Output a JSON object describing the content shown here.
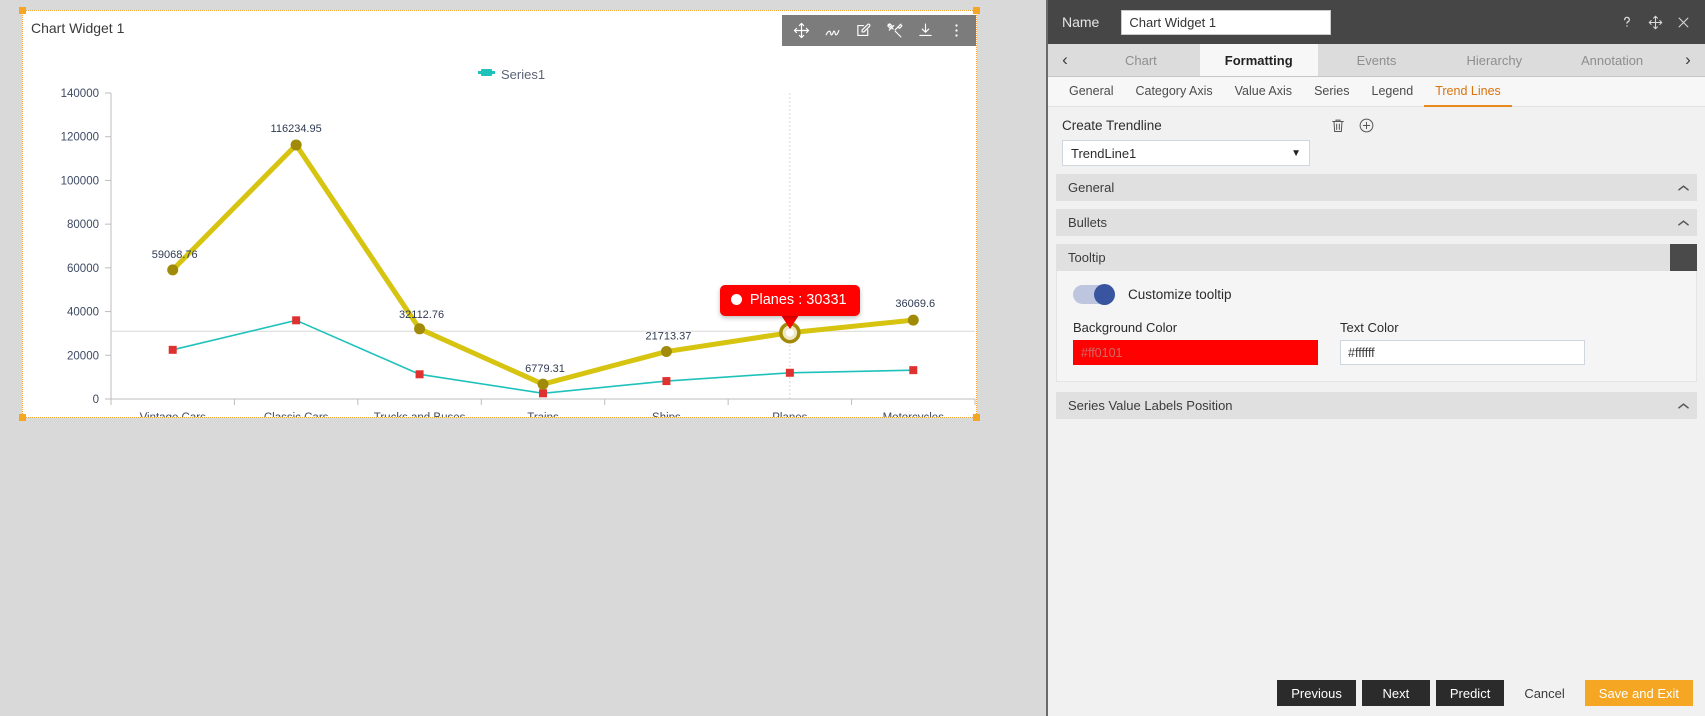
{
  "widget": {
    "title": "Chart Widget 1",
    "toolbar": [
      {
        "name": "move-icon",
        "label": "Move"
      },
      {
        "name": "scribble-icon",
        "label": "Scribble"
      },
      {
        "name": "edit-icon",
        "label": "Edit"
      },
      {
        "name": "tools-icon",
        "label": "Tools"
      },
      {
        "name": "download-icon",
        "label": "Download"
      },
      {
        "name": "more-vertical-icon",
        "label": "More"
      }
    ]
  },
  "chart_data": {
    "type": "line",
    "title": "",
    "xlabel": "",
    "ylabel": "",
    "ylim": [
      0,
      140000
    ],
    "yticks": [
      "0",
      "20000",
      "40000",
      "60000",
      "80000",
      "100000",
      "120000",
      "140000"
    ],
    "ytick_values": [
      0,
      20000,
      40000,
      60000,
      80000,
      100000,
      120000,
      140000
    ],
    "categories": [
      "Vintage Cars",
      "Classic Cars",
      "Trucks and Buses",
      "Trains",
      "Ships",
      "Planes",
      "Motorcycles"
    ],
    "grid": false,
    "legend": {
      "position": "top",
      "entries": [
        {
          "label": "Series1",
          "color": "#1fc2bb"
        }
      ]
    },
    "series": [
      {
        "name": "Series1",
        "color": "#1fc2bb",
        "marker_color": "#e03131",
        "values": [
          22500,
          36000,
          11300,
          2600,
          8200,
          12000,
          13200
        ],
        "show_labels": false
      },
      {
        "name": "TrendLine1",
        "color": "#d6c411",
        "marker_color": "#a08a08",
        "values": [
          59068.76,
          116234.95,
          32112.76,
          6779.31,
          21713.37,
          30330.78,
          36069.6
        ],
        "labels": [
          "59068.76",
          "116234.95",
          "32112.76",
          "6779.31",
          "21713.37",
          "30330.78",
          "36069.6"
        ],
        "show_labels": true
      }
    ],
    "tooltip": {
      "text": "Planes : 30331",
      "category": "Planes",
      "value": "30331",
      "background": "#ff0101",
      "text_color": "#ffffff",
      "anchor_category": "Planes"
    },
    "threshold_line": {
      "value": 31000,
      "color": "#d8d8d8"
    },
    "crosshair_category": "Planes"
  },
  "panel": {
    "name_label": "Name",
    "name_value": "Chart Widget 1",
    "header_icons": [
      {
        "name": "help-icon",
        "glyph": "?"
      },
      {
        "name": "move-panel-icon",
        "glyph": "✥"
      },
      {
        "name": "close-icon",
        "glyph": "✕"
      }
    ],
    "tabs": [
      {
        "label": "Chart",
        "active": false
      },
      {
        "label": "Formatting",
        "active": true
      },
      {
        "label": "Events",
        "active": false
      },
      {
        "label": "Hierarchy",
        "active": false
      },
      {
        "label": "Annotation",
        "active": false
      }
    ],
    "tab_prev_glyph": "‹",
    "tab_next_glyph": "›",
    "subtabs": [
      {
        "label": "General",
        "active": false
      },
      {
        "label": "Category Axis",
        "active": false
      },
      {
        "label": "Value Axis",
        "active": false
      },
      {
        "label": "Series",
        "active": false
      },
      {
        "label": "Legend",
        "active": false
      },
      {
        "label": "Trend Lines",
        "active": true
      }
    ],
    "create_trendline": {
      "label": "Create Trendline",
      "delete_icon": "trash-icon",
      "add_icon": "plus-circle-icon",
      "selected": "TrendLine1",
      "caret": "▼"
    },
    "sections": [
      {
        "label": "General",
        "open": false,
        "chevron": "⌃"
      },
      {
        "label": "Bullets",
        "open": false,
        "chevron": "⌃"
      },
      {
        "label": "Tooltip",
        "open": true,
        "chevron": "⌃"
      },
      {
        "label": "Series Value Labels Position",
        "open": false,
        "chevron": "⌃"
      }
    ],
    "tooltip_section": {
      "toggle_label": "Customize tooltip",
      "toggle_on": true,
      "background_caption": "Background Color",
      "background_value": "#ff0101",
      "text_caption": "Text Color",
      "text_value": "#ffffff"
    },
    "footer_buttons": [
      {
        "label": "Previous",
        "style": "dark"
      },
      {
        "label": "Next",
        "style": "dark"
      },
      {
        "label": "Predict",
        "style": "dark"
      },
      {
        "label": "Cancel",
        "style": "plain"
      },
      {
        "label": "Save and Exit",
        "style": "orange"
      }
    ]
  }
}
